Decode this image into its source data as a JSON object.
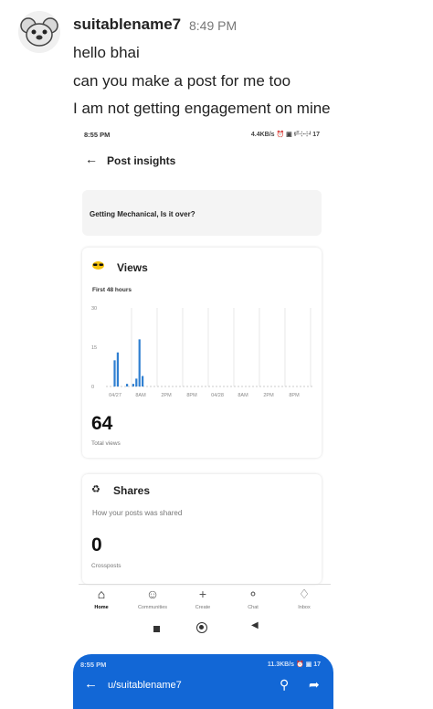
{
  "chat": {
    "username": "suitablename7",
    "time": "8:49 PM",
    "messages": [
      "hello bhai",
      "can you make a post for me too",
      "I am not getting engagement on mine"
    ]
  },
  "screenshot": {
    "status_time": "8:55 PM",
    "status_right": "4.4KB/s ⏰ ▣ ᵍᵀ⸭⸭ᴵ 17",
    "page_title": "Post insights",
    "post_title": "Getting Mechanical, Is it over?",
    "views": {
      "label": "Views",
      "range_label": "First 48 hours",
      "total": "64",
      "total_label": "Total views"
    },
    "shares": {
      "label": "Shares",
      "subtitle": "How your posts was shared",
      "count": "0",
      "count_label": "Crossposts"
    },
    "nav": [
      {
        "label": "Home",
        "icon": "home-icon"
      },
      {
        "label": "Communities",
        "icon": "communities-icon"
      },
      {
        "label": "Create",
        "icon": "plus-icon"
      },
      {
        "label": "Chat",
        "icon": "chat-icon"
      },
      {
        "label": "Inbox",
        "icon": "bell-icon"
      }
    ],
    "colors": {
      "bar": "#2f7fd1",
      "accent": "#1267d6"
    }
  },
  "blue_shot": {
    "status_time": "8:55 PM",
    "status_right": "11.3KB/s ⏰ ▣ 17",
    "title": "u/suitablename7"
  },
  "chart_data": {
    "type": "bar",
    "title": "Views",
    "subtitle": "First 48 hours",
    "x_tick_labels": [
      "04/27",
      "8AM",
      "2PM",
      "8PM",
      "04/28",
      "8AM",
      "2PM",
      "8PM"
    ],
    "y_tick_labels": [
      "30",
      "15",
      "0"
    ],
    "ylim": [
      0,
      30
    ],
    "values": [
      0,
      10,
      13,
      0,
      0,
      1,
      0,
      1,
      3,
      18,
      4,
      0
    ],
    "grid": true
  }
}
